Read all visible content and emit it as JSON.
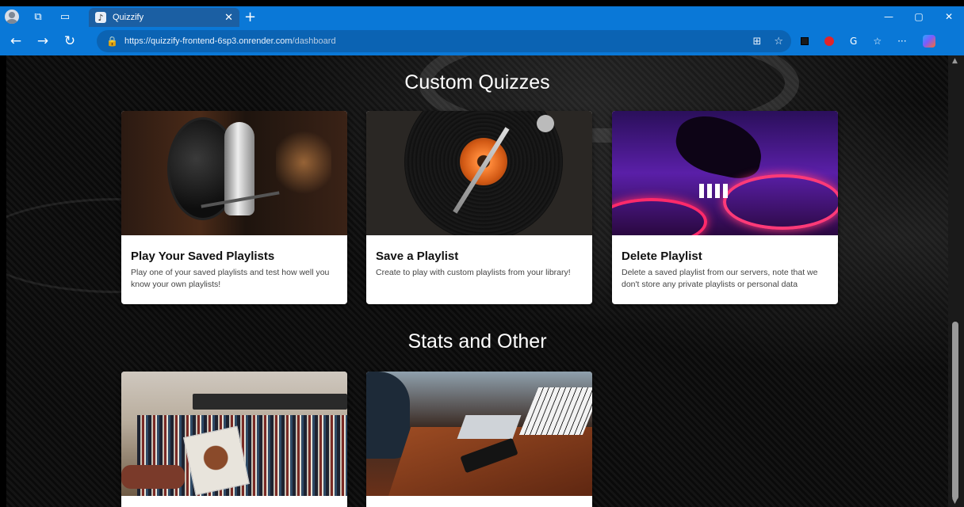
{
  "browser": {
    "tab_title": "Quizzify",
    "tab_favicon": "tiktok-icon",
    "url_main": "https://quizzify-frontend-6sp3.onrender.com",
    "url_path": "/dashboard",
    "accent_color": "#0a78d7"
  },
  "sections": {
    "custom_title": "Custom Quizzes",
    "stats_title": "Stats and Other"
  },
  "cards": {
    "play": {
      "title": "Play Your Saved Playlists",
      "desc": "Play one of your saved playlists and test how well you know your own playlists!"
    },
    "save": {
      "title": "Save a Playlist",
      "desc": "Create to play with custom playlists from your library!"
    },
    "delete": {
      "title": "Delete Playlist",
      "desc": "Delete a saved playlist from our servers, note that we don't store any private playlists or personal data"
    }
  }
}
